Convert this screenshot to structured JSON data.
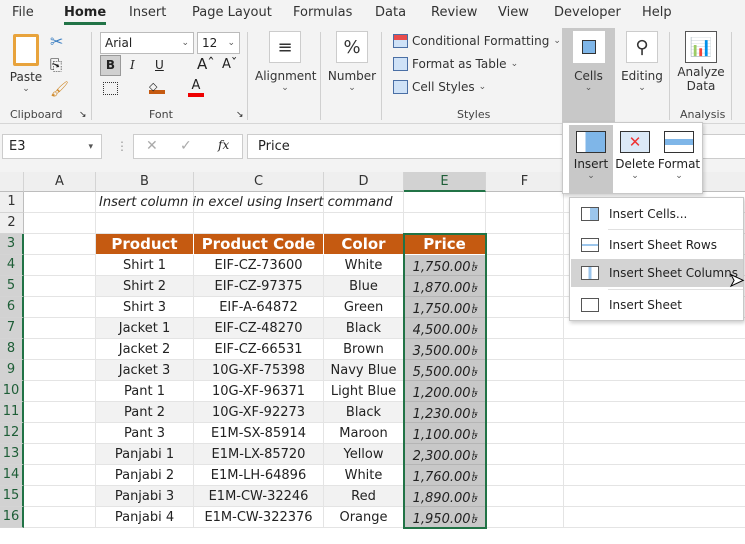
{
  "tabs": [
    "File",
    "Home",
    "Insert",
    "Page Layout",
    "Formulas",
    "Data",
    "Review",
    "View",
    "Developer",
    "Help"
  ],
  "active_tab": "Home",
  "ribbon": {
    "clipboard": {
      "paste": "Paste",
      "label": "Clipboard"
    },
    "font": {
      "name": "Arial",
      "size": "12",
      "bold": "B",
      "italic": "I",
      "underline": "U",
      "label": "Font"
    },
    "alignment": "Alignment",
    "number": "Number",
    "styles": {
      "conditional": "Conditional Formatting",
      "table": "Format as Table",
      "cell_styles": "Cell Styles",
      "label": "Styles"
    },
    "cells": "Cells",
    "editing": "Editing",
    "analysis": {
      "analyze": "Analyze",
      "data": "Data",
      "label": "Analysis"
    }
  },
  "formula_bar": {
    "name_box": "E3",
    "fx": "fx",
    "cancel": "✕",
    "enter": "✓",
    "value": "Price"
  },
  "columns": [
    "A",
    "B",
    "C",
    "D",
    "E",
    "F"
  ],
  "selected_column": "E",
  "rows": [
    "1",
    "2",
    "3",
    "4",
    "5",
    "6",
    "7",
    "8",
    "9",
    "10",
    "11",
    "12",
    "13",
    "14",
    "15",
    "16"
  ],
  "sheet": {
    "title": "Insert column in excel using Insert command",
    "headers": [
      "Product",
      "Product Code",
      "Color",
      "Price"
    ],
    "data": [
      [
        "Shirt 1",
        "EIF-CZ-73600",
        "White",
        "1,750.00৳"
      ],
      [
        "Shirt 2",
        "EIF-CZ-97375",
        "Blue",
        "1,870.00৳"
      ],
      [
        "Shirt 3",
        "EIF-A-64872",
        "Green",
        "1,750.00৳"
      ],
      [
        "Jacket 1",
        "EIF-CZ-48270",
        "Black",
        "4,500.00৳"
      ],
      [
        "Jacket 2",
        "EIF-CZ-66531",
        "Brown",
        "3,500.00৳"
      ],
      [
        "Jacket 3",
        "10G-XF-75398",
        "Navy Blue",
        "5,500.00৳"
      ],
      [
        "Pant 1",
        "10G-XF-96371",
        "Light Blue",
        "1,200.00৳"
      ],
      [
        "Pant 2",
        "10G-XF-92273",
        "Black",
        "1,230.00৳"
      ],
      [
        "Pant 3",
        "E1M-SX-85914",
        "Maroon",
        "1,100.00৳"
      ],
      [
        "Panjabi 1",
        "E1M-LX-85720",
        "Yellow",
        "2,300.00৳"
      ],
      [
        "Panjabi 2",
        "E1M-LH-64896",
        "White",
        "1,760.00৳"
      ],
      [
        "Panjabi 3",
        "E1M-CW-32246",
        "Red",
        "1,890.00৳"
      ],
      [
        "Panjabi 4",
        "E1M-CW-322376",
        "Orange",
        "1,950.00৳"
      ]
    ]
  },
  "cells_menu": {
    "buttons": [
      "Insert",
      "Delete",
      "Format"
    ],
    "items": [
      "Insert Cells...",
      "Insert Sheet Rows",
      "Insert Sheet Columns",
      "Insert Sheet"
    ],
    "highlighted": "Insert Sheet Columns"
  },
  "colors": {
    "header": "#c55a11",
    "accent": "#217346"
  }
}
